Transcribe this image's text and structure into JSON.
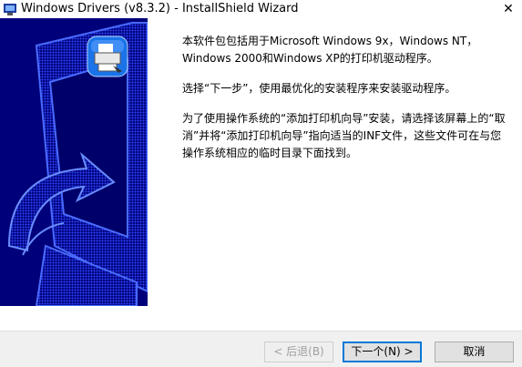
{
  "window": {
    "title": "Windows Drivers (v8.3.2) - InstallShield Wizard",
    "close_glyph": "✕",
    "app_icon": "installshield-computer-icon"
  },
  "welcome": {
    "paragraph1": "本软件包包括用于Microsoft Windows 9x，Windows NT，Windows 2000和Windows XP的打印机驱动程序。",
    "paragraph2": "选择“下一步”，使用最优化的安装程序来安装驱动程序。",
    "paragraph3": "为了使用操作系统的“添加打印机向导”安装，请选择该屏幕上的“取消”并将“添加打印机向导”指向适当的INF文件，这些文件可在与您操作系统相应的临时目录下面找到。"
  },
  "buttons": {
    "back": "< 后退(B)",
    "next": "下一个(N) >",
    "cancel": "取消"
  },
  "colors": {
    "side_panel": "#00007a",
    "side_art": "#2f4bff",
    "footer": "#f0f0f0",
    "focus": "#0078d7"
  },
  "side_panel": {
    "art": "computer-with-arrow-illustration",
    "icon": "printer-setup-icon"
  }
}
